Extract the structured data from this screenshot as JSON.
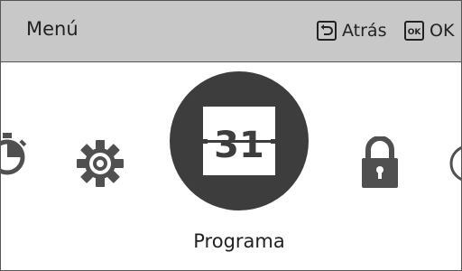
{
  "header": {
    "title": "Menú",
    "back_label": "Atrás",
    "ok_label": "OK",
    "ok_badge": "OK"
  },
  "carousel": {
    "items": [
      {
        "icon": "timer-icon"
      },
      {
        "icon": "gear-icon"
      },
      {
        "icon": "calendar-icon",
        "value": "31",
        "label": "Programa",
        "selected": true
      },
      {
        "icon": "lock-icon"
      },
      {
        "icon": "clock-icon"
      }
    ]
  },
  "colors": {
    "header_bg": "#c8c8c8",
    "icon": "#505050",
    "selected_bg": "#3d3d3d"
  }
}
